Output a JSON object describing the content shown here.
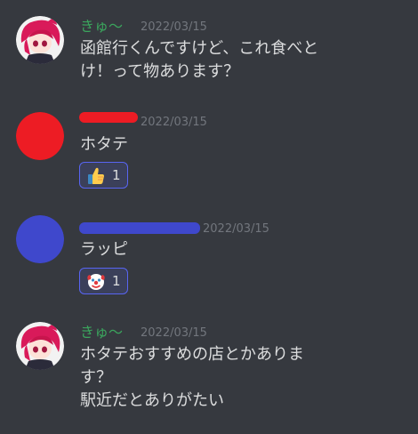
{
  "messages": [
    {
      "author": "きゅ〜",
      "author_color": "#3ba55d",
      "date": "2022/03/15",
      "lines": [
        "函館行くんですけど、これ食べと",
        "け！って物あります？"
      ]
    },
    {
      "author": "",
      "avatar_color": "#ed1c24",
      "redaction_color": "#ed1c24",
      "date": "2022/03/15",
      "lines": [
        "ホタテ"
      ],
      "reaction": {
        "emoji": "thumbs-up",
        "count": "1"
      }
    },
    {
      "author": "",
      "avatar_color": "#3f48cc",
      "redaction_color": "#3f48cc",
      "date": "2022/03/15",
      "lines": [
        "ラッピ"
      ],
      "reaction": {
        "emoji": "clown-face",
        "count": "1"
      }
    },
    {
      "author": "きゅ〜",
      "author_color": "#3ba55d",
      "date": "2022/03/15",
      "lines": [
        "ホタテおすすめの店とかありま",
        "す？",
        "駅近だとありがたい"
      ]
    }
  ],
  "colors": {
    "background": "#36393f",
    "text": "#dcddde",
    "timestamp": "#72767d",
    "reaction_border": "#5865f2",
    "reaction_bg": "#3b405a"
  }
}
